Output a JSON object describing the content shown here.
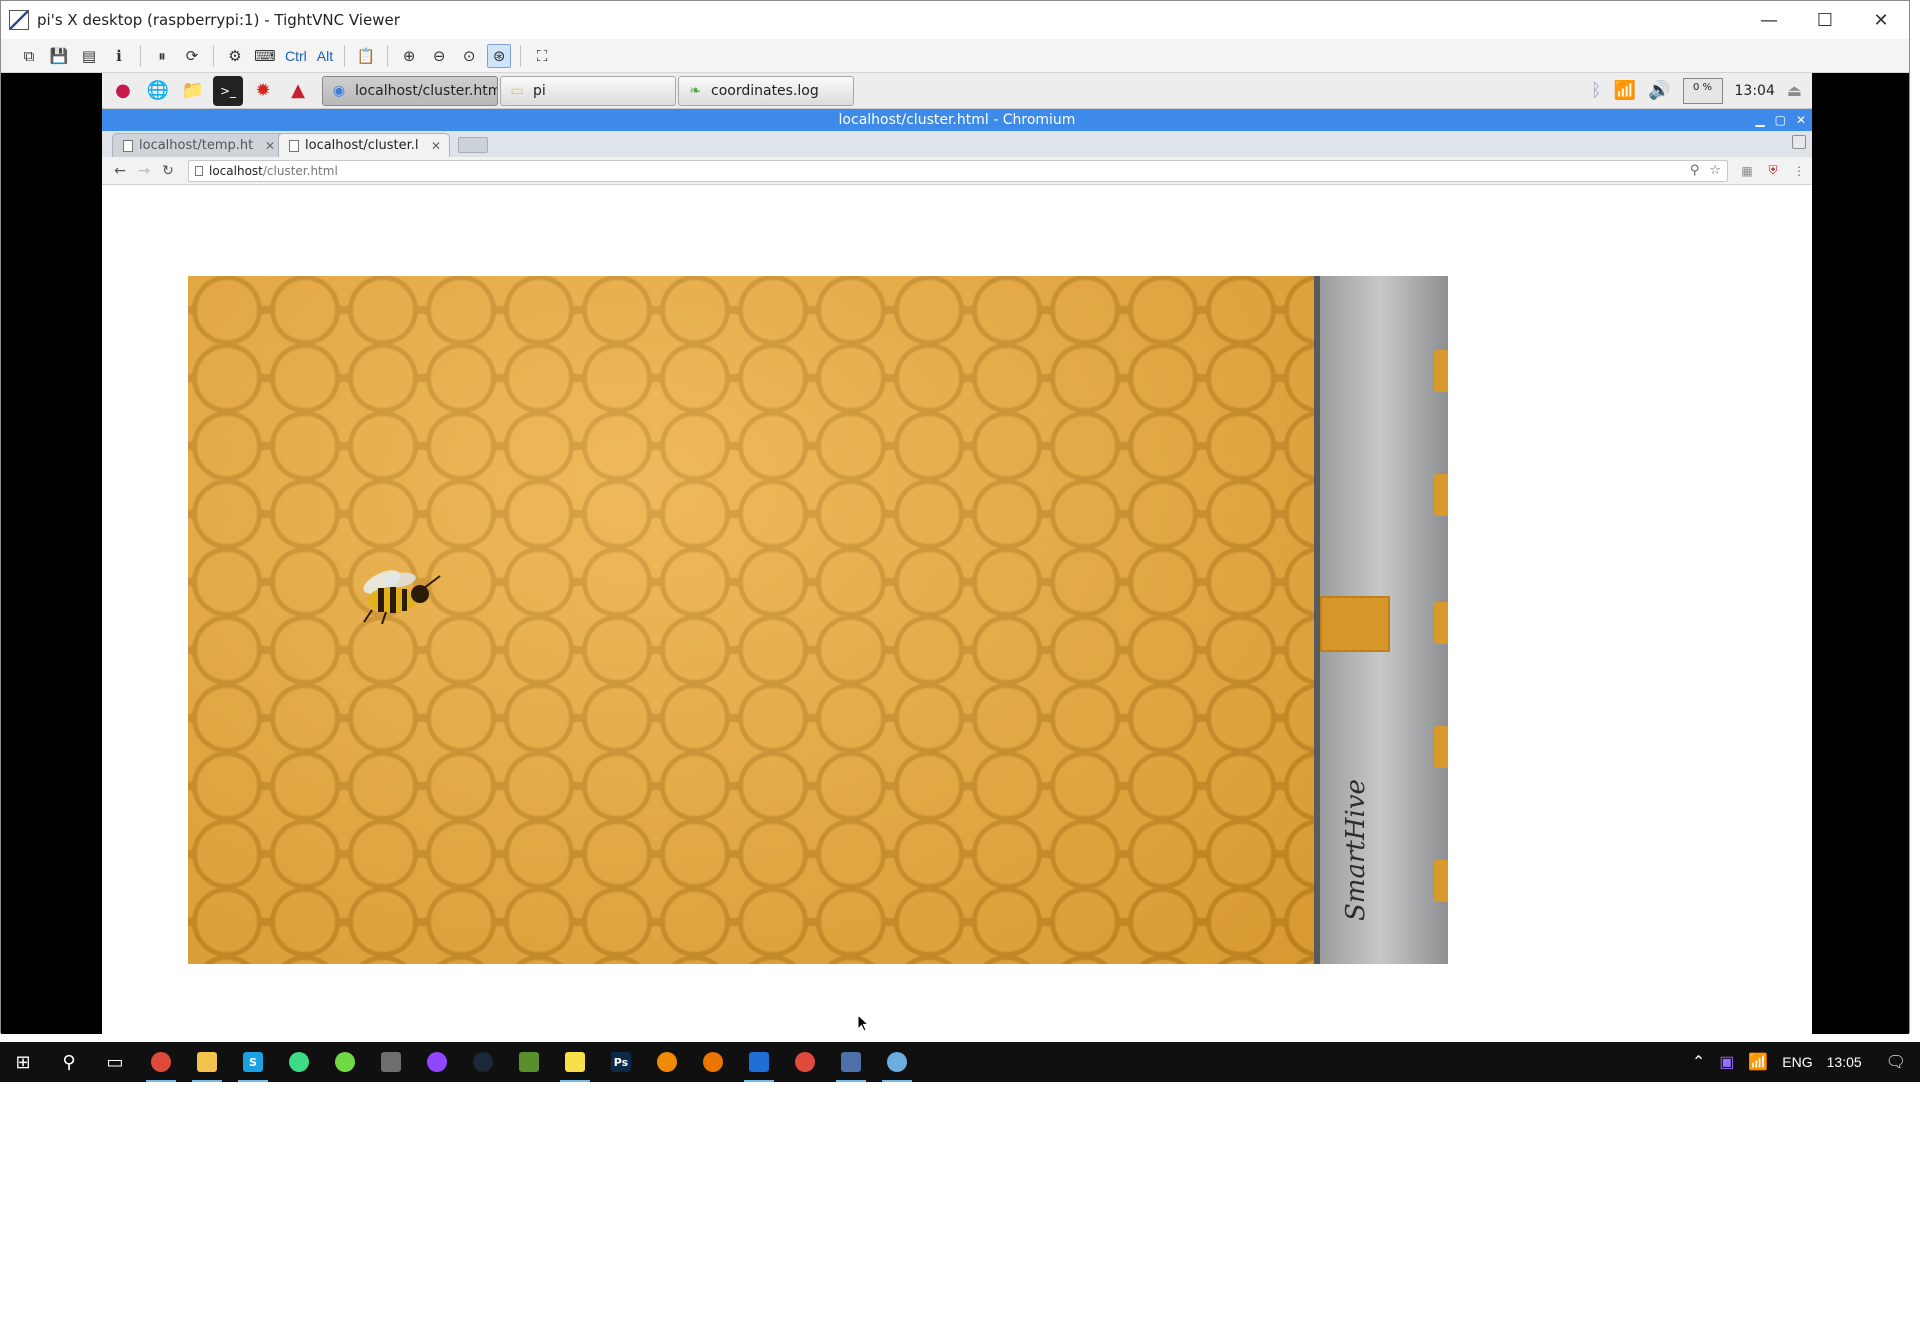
{
  "vnc": {
    "window_title": "pi's X desktop (raspberrypi:1) - TightVNC Viewer",
    "controls": {
      "minimize": "—",
      "maximize": "☐",
      "close": "✕"
    },
    "toolbar": [
      {
        "name": "new-connection-icon",
        "glyph": "⧉"
      },
      {
        "name": "save-icon",
        "glyph": "💾"
      },
      {
        "name": "options-icon",
        "glyph": "▤"
      },
      {
        "name": "info-icon",
        "glyph": "ℹ"
      },
      {
        "sep": true
      },
      {
        "name": "pause-icon",
        "glyph": "⏸"
      },
      {
        "name": "refresh-icon",
        "glyph": "⟳"
      },
      {
        "sep": true
      },
      {
        "name": "send-keys-icon",
        "glyph": "⚙"
      },
      {
        "name": "ctrl-alt-del-icon",
        "glyph": "⌨"
      },
      {
        "name": "ctrl-key",
        "text": "Ctrl"
      },
      {
        "name": "alt-key",
        "text": "Alt"
      },
      {
        "sep": true
      },
      {
        "name": "clipboard-icon",
        "glyph": "📋"
      },
      {
        "sep": true
      },
      {
        "name": "zoom-in-icon",
        "glyph": "⊕"
      },
      {
        "name": "zoom-out-icon",
        "glyph": "⊖"
      },
      {
        "name": "zoom-100-icon",
        "glyph": "⊙"
      },
      {
        "name": "zoom-auto-icon",
        "glyph": "⊛",
        "active": true
      },
      {
        "sep": true
      },
      {
        "name": "fullscreen-icon",
        "glyph": "⛶"
      }
    ]
  },
  "pi": {
    "launchers": [
      {
        "name": "raspberry-menu-icon",
        "glyph": "●",
        "color": "#c51a4a"
      },
      {
        "name": "web-browser-icon",
        "glyph": "🌐",
        "color": "#2f6fcf"
      },
      {
        "name": "file-manager-icon",
        "glyph": "📁",
        "color": "#d8c070"
      },
      {
        "name": "terminal-icon",
        "glyph": ">_",
        "color": "#222"
      },
      {
        "name": "math-icon",
        "glyph": "✹",
        "color": "#d7261e"
      },
      {
        "name": "wolfram-icon",
        "glyph": "▲",
        "color": "#c8202f"
      }
    ],
    "tasks": [
      {
        "name": "task-chromium",
        "label": "localhost/cluster.htm...",
        "icon": "chrome-icon",
        "active": true
      },
      {
        "name": "task-file-manager",
        "label": "pi",
        "icon": "folder-icon",
        "active": false
      },
      {
        "name": "task-editor",
        "label": "coordinates.log",
        "icon": "leaf-icon",
        "active": false
      }
    ],
    "tray": {
      "cpu": "0 %",
      "clock": "13:04"
    }
  },
  "chromium": {
    "window_title": "localhost/cluster.html - Chromium",
    "tabs": [
      {
        "title": "localhost/temp.ht",
        "active": false
      },
      {
        "title": "localhost/cluster.l",
        "active": true
      }
    ],
    "address": {
      "host": "localhost",
      "path": "/cluster.html"
    },
    "image_brand": "SmartHive"
  },
  "windows": {
    "taskbar_apps": [
      {
        "name": "start-icon",
        "glyph": "⊞",
        "running": false
      },
      {
        "name": "search-icon",
        "glyph": "⚲",
        "running": false
      },
      {
        "name": "task-view-icon",
        "glyph": "▭",
        "running": false
      },
      {
        "name": "chrome-icon",
        "color": "#e04a3a",
        "shape": "circ",
        "running": true
      },
      {
        "name": "file-explorer-icon",
        "color": "#f3c24c",
        "shape": "sq",
        "running": true
      },
      {
        "name": "skype-icon",
        "color": "#1aa1e1",
        "shape": "sq",
        "label": "S",
        "running": true
      },
      {
        "name": "android-studio-icon",
        "color": "#3ddc84",
        "shape": "circ",
        "running": false
      },
      {
        "name": "upwork-icon",
        "color": "#6fda44",
        "shape": "circ",
        "running": false
      },
      {
        "name": "calculator-icon",
        "color": "#6e6e6e",
        "shape": "sq",
        "running": false
      },
      {
        "name": "twitch-icon",
        "color": "#9146ff",
        "shape": "circ",
        "running": false
      },
      {
        "name": "steam-icon",
        "color": "#1b2838",
        "shape": "circ",
        "running": false
      },
      {
        "name": "minecraft-icon",
        "color": "#5a8f2c",
        "shape": "sq",
        "running": false
      },
      {
        "name": "sticky-notes-icon",
        "color": "#f8e048",
        "shape": "sq",
        "running": true
      },
      {
        "name": "photoshop-icon",
        "color": "#0b2a4a",
        "shape": "sq",
        "label": "Ps",
        "running": false
      },
      {
        "name": "vlc-icon",
        "color": "#f08a00",
        "shape": "circ",
        "running": false
      },
      {
        "name": "blender-icon",
        "color": "#ea7600",
        "shape": "circ",
        "running": false
      },
      {
        "name": "ide-icon",
        "color": "#1f6fd6",
        "shape": "sq",
        "running": true
      },
      {
        "name": "chrome-2-icon",
        "color": "#e04a3a",
        "shape": "circ",
        "running": false
      },
      {
        "name": "tightvnc-icon",
        "color": "#4f6fa8",
        "shape": "sq",
        "running": true
      },
      {
        "name": "paint-icon",
        "color": "#6aaee0",
        "shape": "circ",
        "running": true
      }
    ],
    "tray": {
      "language": "ENG",
      "clock": "13:05"
    }
  }
}
